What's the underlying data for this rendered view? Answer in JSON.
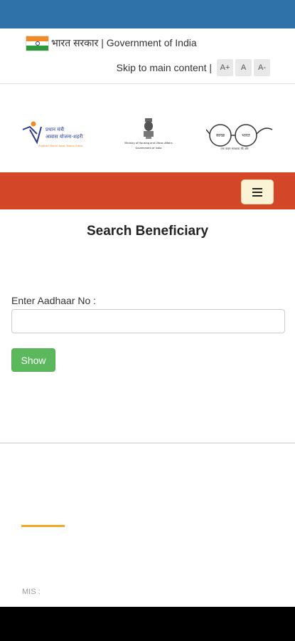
{
  "header": {
    "gov_label": "भारत सरकार | Government of India",
    "skip_link": "Skip to main content |",
    "font_controls": [
      "A+",
      "A",
      "A-"
    ]
  },
  "logos": {
    "pmay": {
      "line1": "प्रधान मंत्री",
      "line2": "आवास योजना-शहरी",
      "line3": "Pradhan Mantri Awas Yojana-Urban"
    },
    "ministry": {
      "line1": "Ministry of Housing and Urban Affairs",
      "line2": "Government of India"
    },
    "swachh": {
      "word1": "स्वच्छ",
      "word2": "भारत",
      "tagline": "एक कदम स्वच्छता की ओर"
    }
  },
  "colors": {
    "status_bar": "#2f72a9",
    "navbar": "#d34627",
    "show_button": "#5cb85c",
    "accent": "#f5a623"
  },
  "main": {
    "title": "Search Beneficiary",
    "aadhaar_label": "Enter Aadhaar No :",
    "aadhaar_value": "",
    "show_button": "Show"
  },
  "footer": {
    "mis_label": "MIS :"
  }
}
